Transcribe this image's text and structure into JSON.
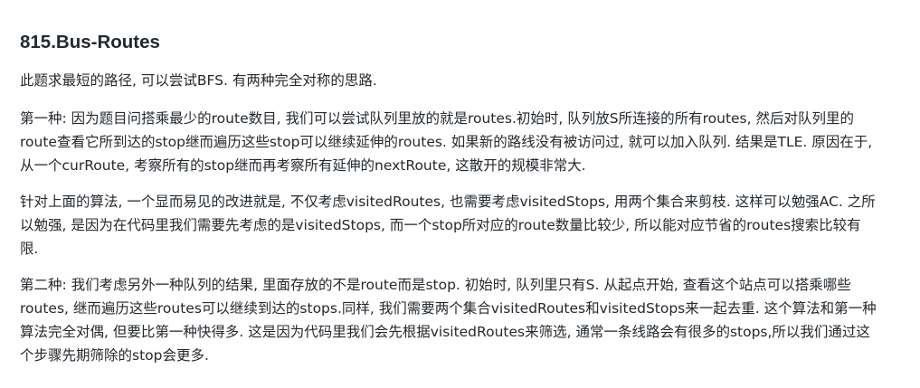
{
  "document": {
    "title": "815.Bus-Routes",
    "paragraphs": [
      "此题求最短的路径, 可以尝试BFS. 有两种完全对称的思路.",
      "第一种: 因为题目问搭乘最少的route数目, 我们可以尝试队列里放的就是routes.初始时, 队列放S所连接的所有routes, 然后对队列里的route查看它所到达的stop继而遍历这些stop可以继续延伸的routes. 如果新的路线没有被访问过, 就可以加入队列. 结果是TLE. 原因在于, 从一个curRoute, 考察所有的stop继而再考察所有延伸的nextRoute, 这散开的规模非常大.",
      "针对上面的算法, 一个显而易见的改进就是, 不仅考虑visitedRoutes, 也需要考虑visitedStops, 用两个集合来剪枝. 这样可以勉强AC. 之所以勉强, 是因为在代码里我们需要先考虑的是visitedStops, 而一个stop所对应的route数量比较少, 所以能对应节省的routes搜索比较有限.",
      "第二种: 我们考虑另外一种队列的结果, 里面存放的不是route而是stop. 初始时, 队列里只有S. 从起点开始, 查看这个站点可以搭乘哪些routes, 继而遍历这些routes可以继续到达的stops.同样, 我们需要两个集合visitedRoutes和visitedStops来一起去重. 这个算法和第一种算法完全对偶, 但要比第一种快得多. 这是因为代码里我们会先根据visitedRoutes来筛选, 通常一条线路会有很多的stops,所以我们通过这个步骤先期筛除的stop会更多."
    ]
  }
}
